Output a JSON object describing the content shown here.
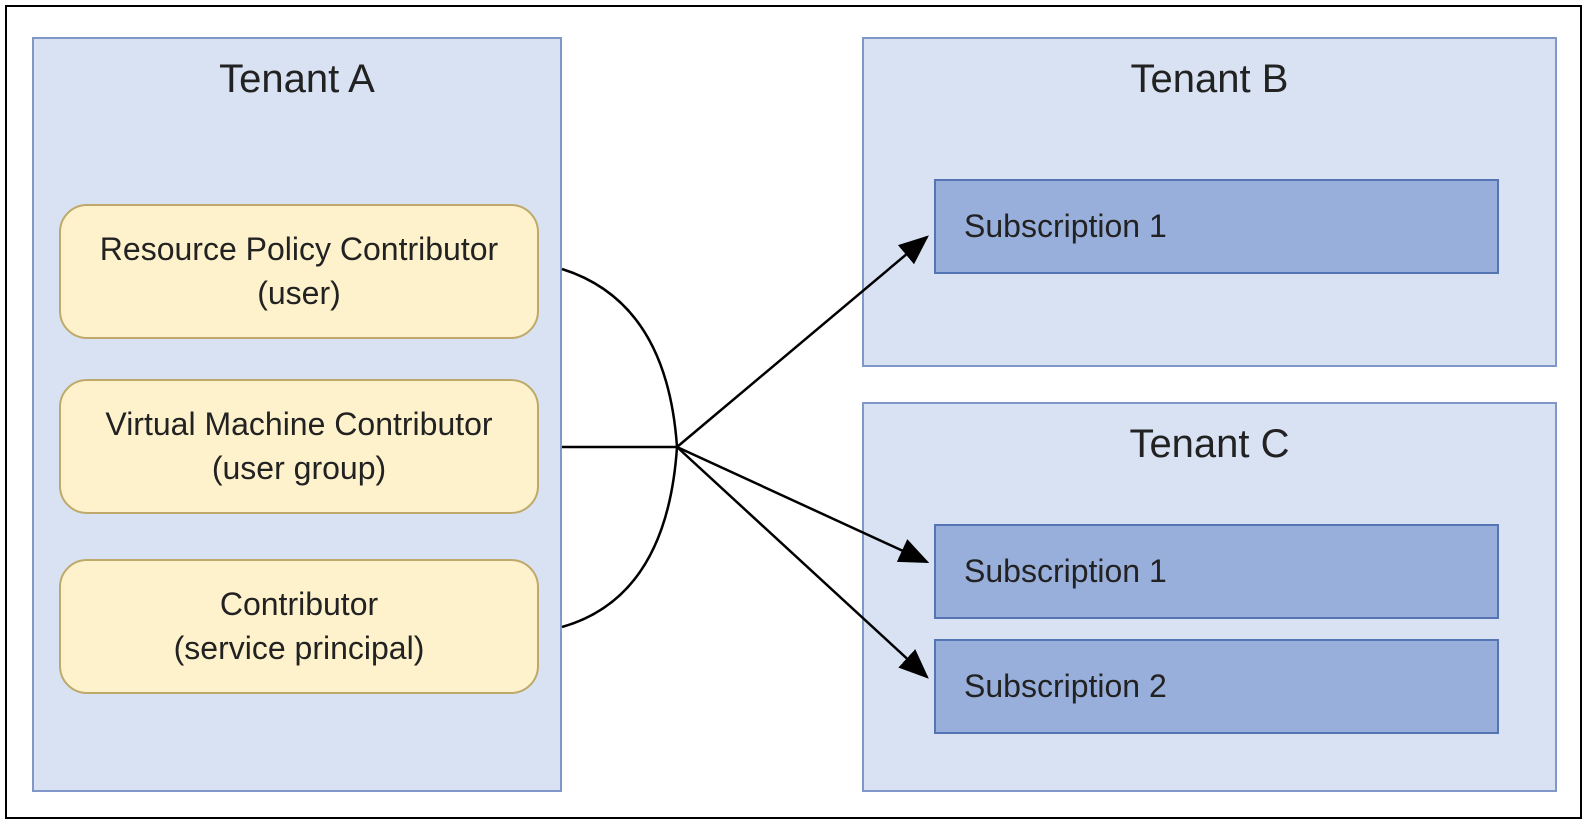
{
  "tenantA": {
    "title": "Tenant A",
    "roles": [
      {
        "name": "Resource Policy Contributor",
        "principal": "(user)"
      },
      {
        "name": "Virtual Machine Contributor",
        "principal": "(user group)"
      },
      {
        "name": "Contributor",
        "principal": "(service principal)"
      }
    ]
  },
  "tenantB": {
    "title": "Tenant B",
    "subscriptions": [
      "Subscription 1"
    ]
  },
  "tenantC": {
    "title": "Tenant C",
    "subscriptions": [
      "Subscription 1",
      "Subscription 2"
    ]
  }
}
